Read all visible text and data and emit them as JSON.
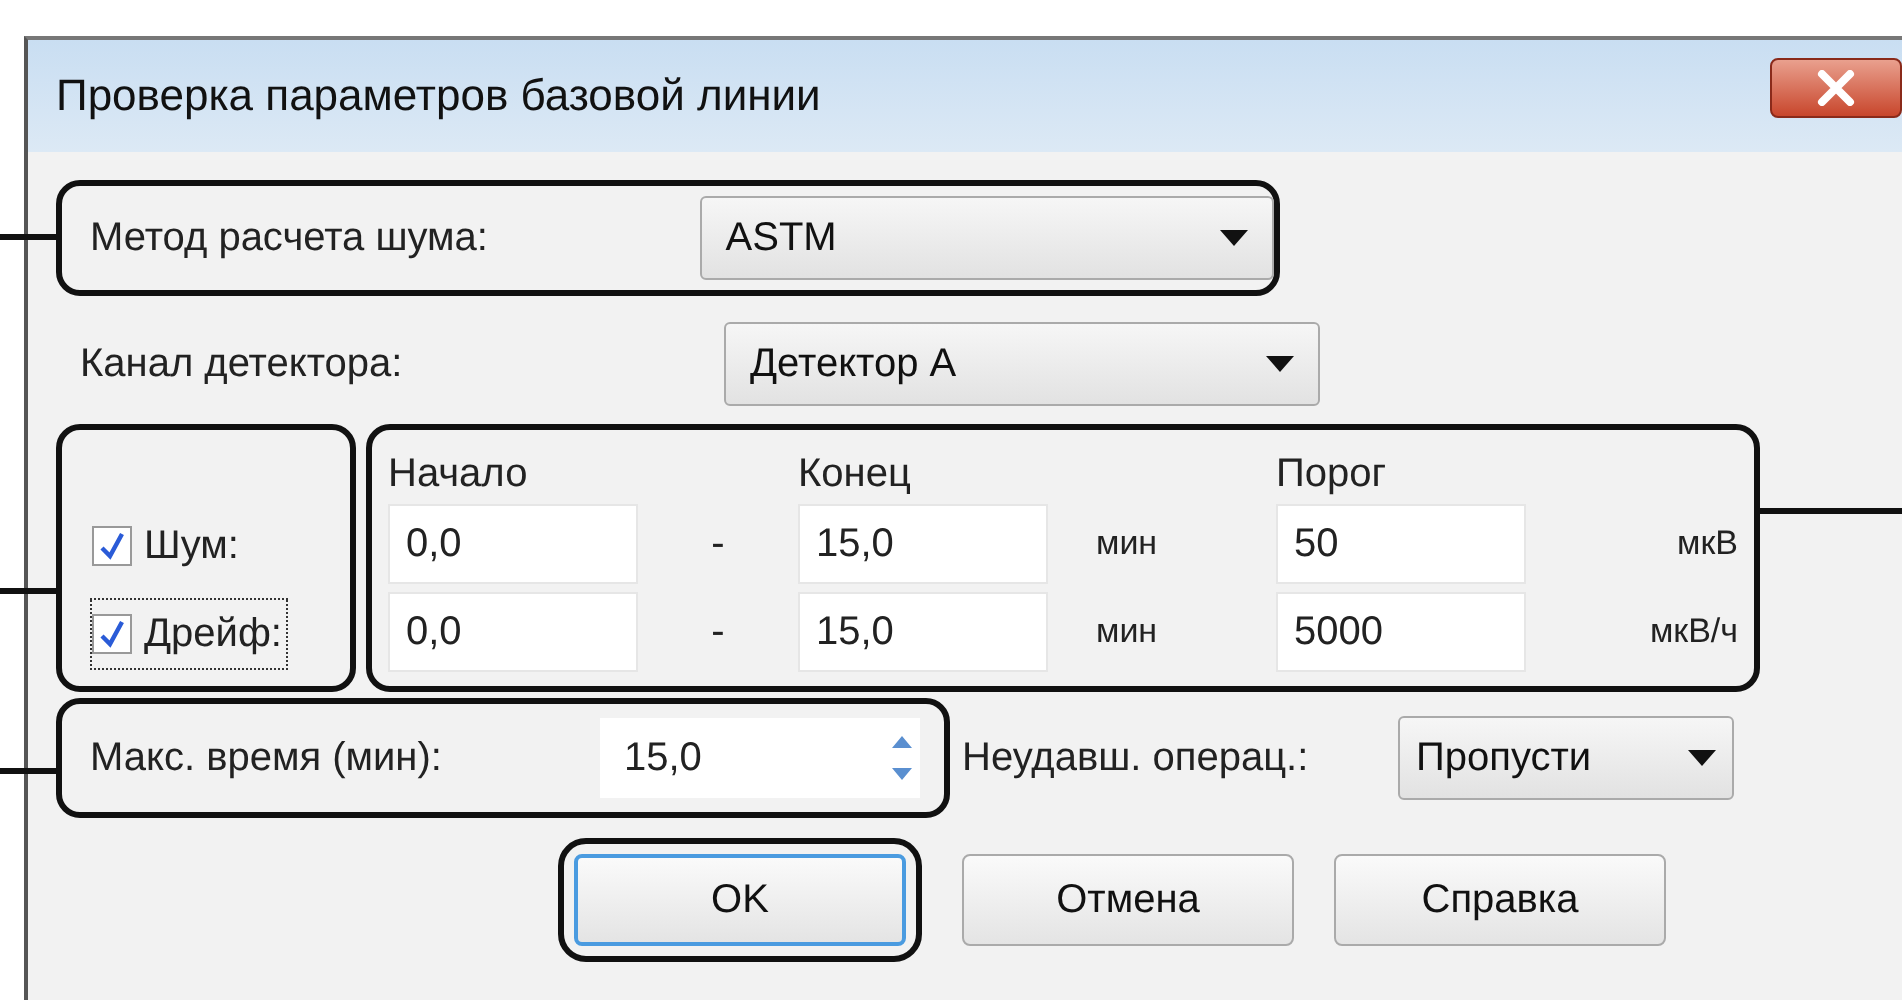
{
  "window": {
    "title": "Проверка параметров базовой линии"
  },
  "noise_method": {
    "label": "Метод расчета шума:",
    "value": "ASTM"
  },
  "detector_channel": {
    "label": "Канал детектора:",
    "value": "Детектор А"
  },
  "range_headers": [
    "Начало",
    "Конец",
    "Порог"
  ],
  "rows": [
    {
      "label": "Шум:",
      "checked": true,
      "focused": false,
      "start": "0,0",
      "dash": "-",
      "end": "15,0",
      "end_unit": "мин",
      "threshold": "50",
      "threshold_unit": "мкВ"
    },
    {
      "label": "Дрейф:",
      "checked": true,
      "focused": true,
      "start": "0,0",
      "dash": "-",
      "end": "15,0",
      "end_unit": "мин",
      "threshold": "5000",
      "threshold_unit": "мкВ/ч"
    }
  ],
  "max_time": {
    "label": "Макс. время (мин):",
    "value": "15,0"
  },
  "failed_operation": {
    "label": "Неудавш. операц.:",
    "value": "Пропусти"
  },
  "buttons": [
    {
      "label": "OK",
      "default": true
    },
    {
      "label": "Отмена",
      "default": false
    },
    {
      "label": "Справка",
      "default": false
    }
  ]
}
